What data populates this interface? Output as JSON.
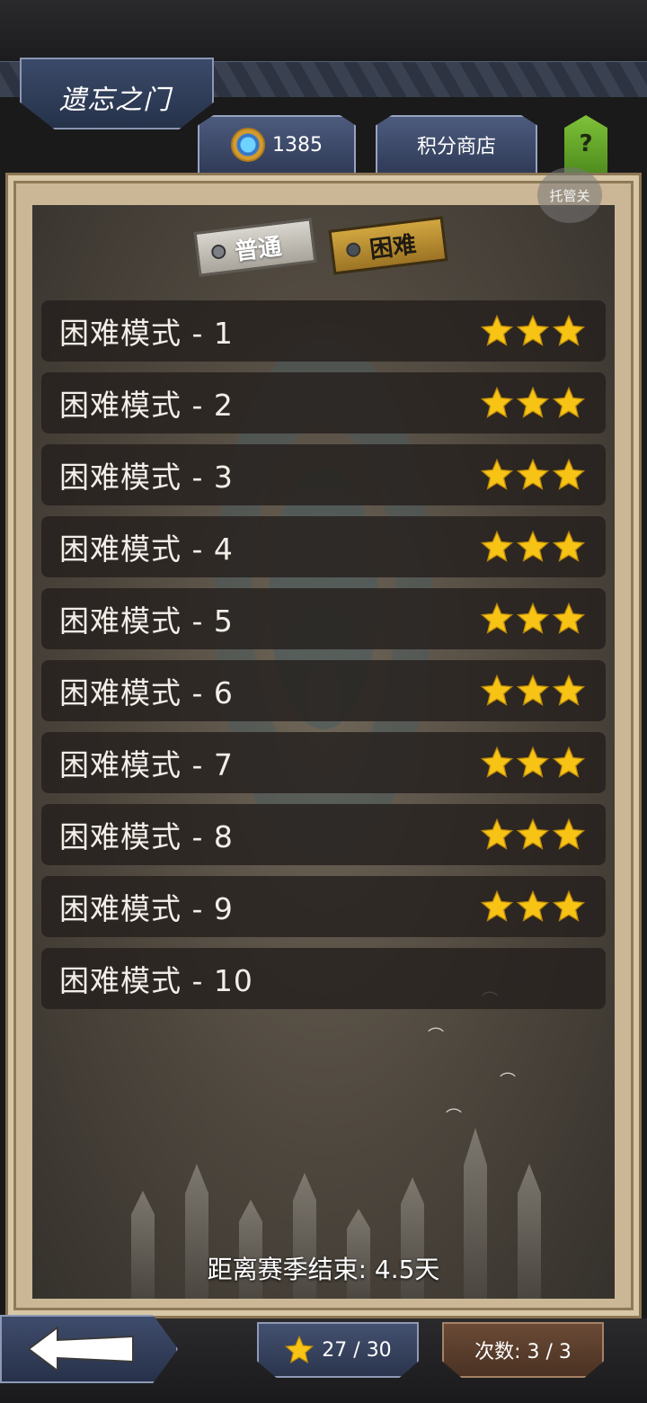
{
  "header": {
    "title": "遗忘之门",
    "score_value": "1385",
    "shop_label": "积分商店",
    "help_label": "?",
    "close_hint": "托管关"
  },
  "tabs": {
    "normal_label": "普通",
    "hard_label": "困难",
    "selected": "困难"
  },
  "levels": [
    {
      "name": "困难模式 - 1",
      "stars": 3
    },
    {
      "name": "困难模式 - 2",
      "stars": 3
    },
    {
      "name": "困难模式 - 3",
      "stars": 3
    },
    {
      "name": "困难模式 - 4",
      "stars": 3
    },
    {
      "name": "困难模式 - 5",
      "stars": 3
    },
    {
      "name": "困难模式 - 6",
      "stars": 3
    },
    {
      "name": "困难模式 - 7",
      "stars": 3
    },
    {
      "name": "困难模式 - 8",
      "stars": 3
    },
    {
      "name": "困难模式 - 9",
      "stars": 3
    },
    {
      "name": "困难模式 - 10",
      "stars": 0
    }
  ],
  "season": {
    "text": "距离赛季结束: 4.5天"
  },
  "footer": {
    "stars_collected": "27 / 30",
    "attempts": "次数: 3 / 3"
  },
  "colors": {
    "star_fill": "#f7c315",
    "panel_frame": "#cbb795",
    "tab_hard": "#c89c3a"
  }
}
